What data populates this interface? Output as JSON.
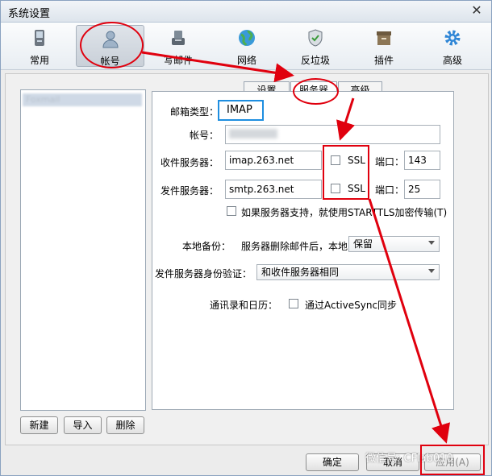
{
  "window": {
    "title": "系统设置",
    "close": "✕"
  },
  "toolbar": {
    "items": [
      {
        "label": "常用",
        "icon": "general-icon"
      },
      {
        "label": "帐号",
        "icon": "account-icon"
      },
      {
        "label": "写邮件",
        "icon": "compose-icon"
      },
      {
        "label": "网络",
        "icon": "network-icon"
      },
      {
        "label": "反垃圾",
        "icon": "antispam-icon"
      },
      {
        "label": "插件",
        "icon": "plugin-icon"
      },
      {
        "label": "高级",
        "icon": "advanced-icon"
      }
    ]
  },
  "account_list": {
    "selected": "Foxmail"
  },
  "account_buttons": {
    "new": "新建",
    "import": "导入",
    "delete": "删除"
  },
  "tabs": {
    "settings": "设置",
    "server": "服务器",
    "advanced": "高级"
  },
  "server": {
    "mail_type_label": "邮箱类型：",
    "mail_type_value": "IMAP",
    "account_label": "帐号：",
    "account_value": "",
    "incoming_label": "收件服务器：",
    "incoming_value": "imap.263.net",
    "outgoing_label": "发件服务器：",
    "outgoing_value": "smtp.263.net",
    "ssl_label": "SSL",
    "port_label": "端口：",
    "incoming_port": "143",
    "outgoing_port": "25",
    "starttls_label": "如果服务器支持，就使用STARTTLS加密传输(T)",
    "backup_label": "本地备份：",
    "backup_text": "服务器删除邮件后，本地",
    "backup_value": "保留",
    "auth_label": "发件服务器身份验证：",
    "auth_value": "和收件服务器相同",
    "sync_label": "通讯录和日历：",
    "sync_text": "通过ActiveSync同步"
  },
  "footer": {
    "ok": "确定",
    "cancel": "取消",
    "apply": "应用(A)"
  },
  "watermark": "微信号: CFlab010",
  "colors": {
    "annotation_red": "#e0000e",
    "annotation_blue": "#1e8ee0"
  }
}
